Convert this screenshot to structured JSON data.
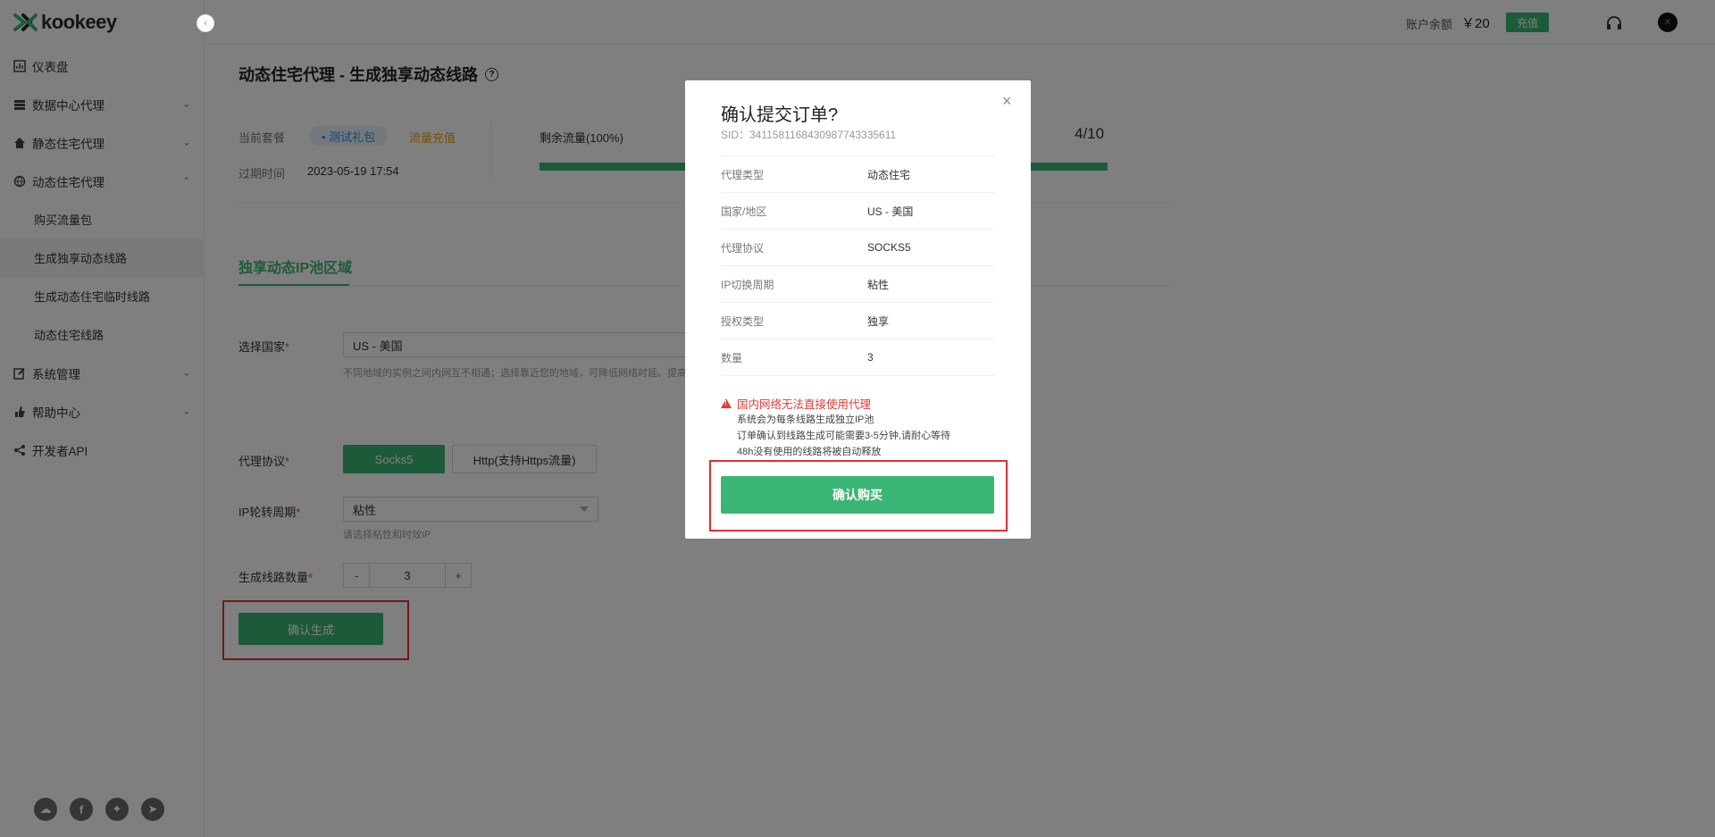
{
  "app": {
    "brand": "kookeey",
    "brand_color": "#3bb575"
  },
  "topbar": {
    "balance_label": "账户余额",
    "balance_value": "￥20",
    "recharge_label": "充值",
    "support_icon": "headset-icon",
    "avatar_icon": "avatar-icon"
  },
  "sidebar": {
    "items": [
      {
        "label": "仪表盘",
        "icon": "dashboard-icon"
      },
      {
        "label": "数据中心代理",
        "icon": "server-icon"
      },
      {
        "label": "静态住宅代理",
        "icon": "home-icon"
      },
      {
        "label": "动态住宅代理",
        "icon": "globe-icon"
      },
      {
        "label": "系统管理",
        "icon": "edit-icon"
      },
      {
        "label": "帮助中心",
        "icon": "hand-icon"
      },
      {
        "label": "开发者API",
        "icon": "api-icon"
      }
    ],
    "sub_items": [
      {
        "label": "购买流量包"
      },
      {
        "label": "生成独享动态线路"
      },
      {
        "label": "生成动态住宅临时线路"
      },
      {
        "label": "动态住宅线路"
      }
    ],
    "social_icons": [
      "wechat-icon",
      "facebook-icon",
      "twitter-icon",
      "telegram-icon"
    ]
  },
  "main": {
    "page_title": "动态住宅代理 - 生成独享动态线路",
    "package_label": "当前套餐",
    "package_tag": "• 测试礼包",
    "package_recharge": "流量充值",
    "expire_label": "过期时间",
    "expire_value": "2023-05-19 17:54",
    "flow_label": "剩余流量(100%)",
    "flow_count": "4/10",
    "flow_fraction": 1.0,
    "tab_label": "独享动态IP池区域",
    "form": {
      "country_label": "选择国家",
      "country_value": "US - 美国",
      "country_hint": "不同地域的实例之间内网互不相通；选择靠近您的地域，可降低网络时延、提高您",
      "protocol_label": "代理协议",
      "protocol_options": [
        "Socks5",
        "Http(支持Https流量)"
      ],
      "ip_label": "IP轮转周期",
      "ip_value": "粘性",
      "ip_hint": "请选择粘性和时效IP",
      "count_label": "生成线路数量",
      "count_minus": "-",
      "count_value": "3",
      "count_plus": "+",
      "required_mark": "*",
      "generate_label": "确认生成"
    }
  },
  "modal": {
    "title": "确认提交订单?",
    "sid": "SID：3411581168430987743335611",
    "close": "×",
    "rows": [
      {
        "key": "代理类型",
        "value": "动态住宅"
      },
      {
        "key": "国家/地区",
        "value": "US - 美国"
      },
      {
        "key": "代理协议",
        "value": "SOCKS5"
      },
      {
        "key": "IP切换周期",
        "value": "粘性"
      },
      {
        "key": "授权类型",
        "value": "独享"
      },
      {
        "key": "数量",
        "value": "3"
      }
    ],
    "warning": "国内网络无法直接使用代理",
    "notes": [
      "系统会为每条线路生成独立IP池",
      "订单确认到线路生成可能需要3-5分钟,请耐心等待",
      "48h没有使用的线路将被自动释放"
    ],
    "confirm_label": "确认购买"
  }
}
